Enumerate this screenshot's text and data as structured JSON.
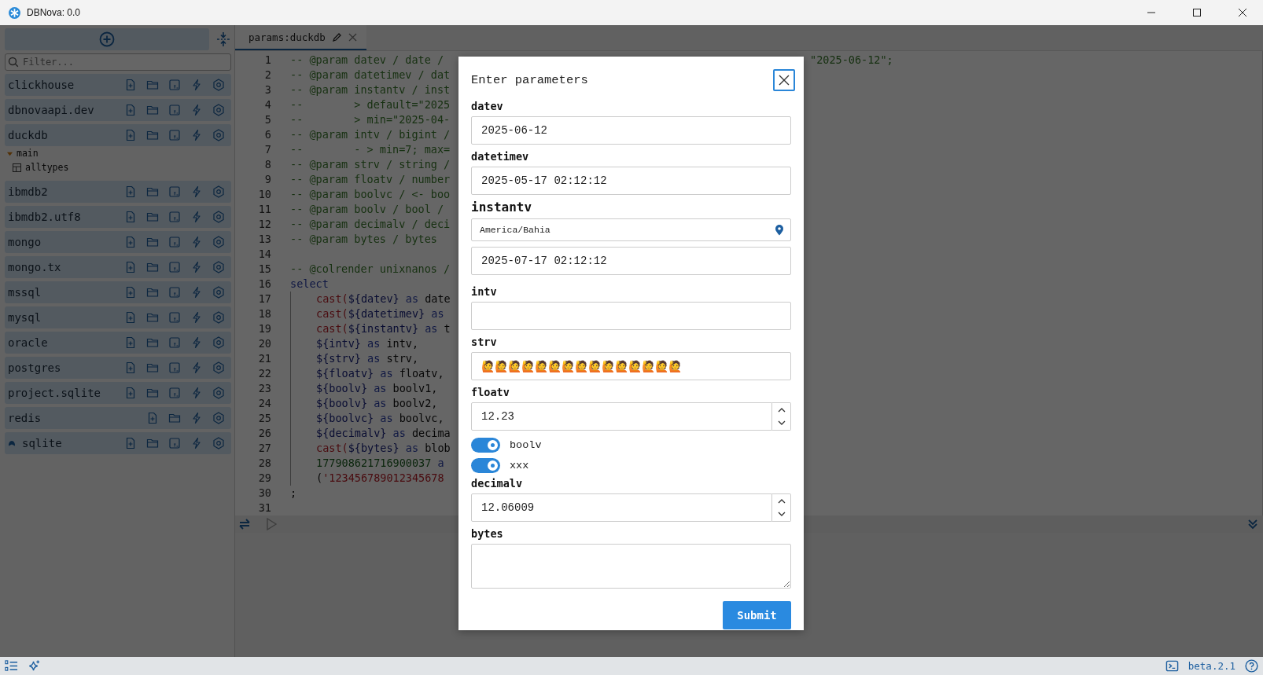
{
  "window": {
    "title": "DBNova: 0.0"
  },
  "sidebar": {
    "filter_placeholder": "Filter...",
    "connections": [
      {
        "name": "clickhouse",
        "pinned": false,
        "actions": [
          {
            "kind": "new-file"
          },
          {
            "kind": "folder"
          },
          {
            "kind": "script"
          },
          {
            "kind": "bolt"
          },
          {
            "kind": "settings"
          }
        ]
      },
      {
        "name": "dbnovaapi.dev",
        "pinned": false,
        "actions": [
          {
            "kind": "new-file"
          },
          {
            "kind": "folder"
          },
          {
            "kind": "script"
          },
          {
            "kind": "bolt"
          },
          {
            "kind": "settings"
          }
        ]
      },
      {
        "name": "duckdb",
        "pinned": false,
        "actions": [
          {
            "kind": "new-file"
          },
          {
            "kind": "folder"
          },
          {
            "kind": "script"
          },
          {
            "kind": "bolt"
          },
          {
            "kind": "settings"
          }
        ],
        "children": [
          {
            "label": "main",
            "expanded": true,
            "children": [
              {
                "label": "alltypes"
              }
            ]
          }
        ]
      },
      {
        "name": "ibmdb2",
        "pinned": false,
        "actions": [
          {
            "kind": "new-file"
          },
          {
            "kind": "folder"
          },
          {
            "kind": "script"
          },
          {
            "kind": "bolt"
          },
          {
            "kind": "settings"
          }
        ]
      },
      {
        "name": "ibmdb2.utf8",
        "pinned": false,
        "actions": [
          {
            "kind": "new-file"
          },
          {
            "kind": "folder"
          },
          {
            "kind": "script"
          },
          {
            "kind": "bolt"
          },
          {
            "kind": "settings"
          }
        ]
      },
      {
        "name": "mongo",
        "pinned": false,
        "actions": [
          {
            "kind": "new-file"
          },
          {
            "kind": "folder"
          },
          {
            "kind": "script"
          },
          {
            "kind": "bolt"
          },
          {
            "kind": "settings"
          }
        ]
      },
      {
        "name": "mongo.tx",
        "pinned": false,
        "actions": [
          {
            "kind": "new-file"
          },
          {
            "kind": "folder"
          },
          {
            "kind": "script"
          },
          {
            "kind": "bolt"
          },
          {
            "kind": "settings"
          }
        ]
      },
      {
        "name": "mssql",
        "pinned": false,
        "actions": [
          {
            "kind": "new-file"
          },
          {
            "kind": "folder"
          },
          {
            "kind": "script"
          },
          {
            "kind": "bolt"
          },
          {
            "kind": "settings"
          }
        ]
      },
      {
        "name": "mysql",
        "pinned": false,
        "actions": [
          {
            "kind": "new-file"
          },
          {
            "kind": "folder"
          },
          {
            "kind": "script"
          },
          {
            "kind": "bolt"
          },
          {
            "kind": "settings"
          }
        ]
      },
      {
        "name": "oracle",
        "pinned": false,
        "actions": [
          {
            "kind": "new-file"
          },
          {
            "kind": "folder"
          },
          {
            "kind": "script"
          },
          {
            "kind": "bolt"
          },
          {
            "kind": "settings"
          }
        ]
      },
      {
        "name": "postgres",
        "pinned": false,
        "actions": [
          {
            "kind": "new-file"
          },
          {
            "kind": "folder"
          },
          {
            "kind": "script"
          },
          {
            "kind": "bolt"
          },
          {
            "kind": "settings"
          }
        ]
      },
      {
        "name": "project.sqlite",
        "pinned": false,
        "actions": [
          {
            "kind": "new-file"
          },
          {
            "kind": "folder"
          },
          {
            "kind": "script"
          },
          {
            "kind": "bolt"
          },
          {
            "kind": "settings"
          }
        ]
      },
      {
        "name": "redis",
        "pinned": false,
        "actions": [
          {
            "kind": "new-file"
          },
          {
            "kind": "folder"
          },
          {
            "kind": "bolt"
          },
          {
            "kind": "settings"
          }
        ]
      },
      {
        "name": "sqlite",
        "pinned": true,
        "actions": [
          {
            "kind": "new-file"
          },
          {
            "kind": "folder"
          },
          {
            "kind": "script"
          },
          {
            "kind": "bolt"
          },
          {
            "kind": "settings"
          }
        ]
      }
    ]
  },
  "editor": {
    "tabs": [
      {
        "label": "params:duckdb",
        "selected": true
      }
    ],
    "lines": [
      {
        "n": "1",
        "kind": "comment",
        "text": "-- @param datev / date /",
        "tail": "\"2025-06-12\";"
      },
      {
        "n": "2",
        "kind": "comment",
        "text": "-- @param datetimev / dat"
      },
      {
        "n": "3",
        "kind": "comment",
        "text": "-- @param instantv / inst"
      },
      {
        "n": "4",
        "kind": "comment",
        "text": "--        > default=\"2025"
      },
      {
        "n": "5",
        "kind": "comment",
        "text": "--        > min=\"2025-04-"
      },
      {
        "n": "6",
        "kind": "comment",
        "text": "-- @param intv / bigint /"
      },
      {
        "n": "7",
        "kind": "comment",
        "text": "--        - > min=7; max="
      },
      {
        "n": "8",
        "kind": "comment",
        "text": "-- @param strv / string /"
      },
      {
        "n": "9",
        "kind": "comment",
        "text": "-- @param floatv / number"
      },
      {
        "n": "10",
        "kind": "comment",
        "text": "-- @param boolvc / <- boo"
      },
      {
        "n": "11",
        "kind": "comment",
        "text": "-- @param boolv / bool /"
      },
      {
        "n": "12",
        "kind": "comment",
        "text": "-- @param decimalv / deci"
      },
      {
        "n": "13",
        "kind": "comment",
        "text": "-- @param bytes / bytes"
      },
      {
        "n": "14",
        "kind": "blank"
      },
      {
        "n": "15",
        "kind": "comment",
        "text": "-- @colrender unixnanos /"
      },
      {
        "n": "16",
        "kind": "keyword",
        "text": "select"
      },
      {
        "n": "17",
        "kind": "body",
        "segments": [
          {
            "t": "cast(",
            "kind": "fn"
          },
          {
            "t": "${datev}",
            "kind": "var"
          },
          {
            "t": " as ",
            "kind": "kw"
          },
          {
            "t": "date",
            "kind": "id"
          }
        ]
      },
      {
        "n": "18",
        "kind": "body",
        "segments": [
          {
            "t": "cast(",
            "kind": "fn"
          },
          {
            "t": "${datetimev}",
            "kind": "var"
          },
          {
            "t": " as",
            "kind": "kw"
          }
        ]
      },
      {
        "n": "19",
        "kind": "body",
        "segments": [
          {
            "t": "cast(",
            "kind": "fn"
          },
          {
            "t": "${instantv}",
            "kind": "var"
          },
          {
            "t": " as ",
            "kind": "kw"
          },
          {
            "t": "t",
            "kind": "id"
          }
        ]
      },
      {
        "n": "20",
        "kind": "body",
        "segments": [
          {
            "t": "${intv}",
            "kind": "var"
          },
          {
            "t": " as ",
            "kind": "kw"
          },
          {
            "t": "intv,",
            "kind": "id"
          }
        ]
      },
      {
        "n": "21",
        "kind": "body",
        "segments": [
          {
            "t": "${strv}",
            "kind": "var"
          },
          {
            "t": " as ",
            "kind": "kw"
          },
          {
            "t": "strv,",
            "kind": "id"
          }
        ]
      },
      {
        "n": "22",
        "kind": "body",
        "segments": [
          {
            "t": "${floatv}",
            "kind": "var"
          },
          {
            "t": " as ",
            "kind": "kw"
          },
          {
            "t": "floatv,",
            "kind": "id"
          }
        ]
      },
      {
        "n": "23",
        "kind": "body",
        "segments": [
          {
            "t": "${boolv}",
            "kind": "var"
          },
          {
            "t": " as ",
            "kind": "kw"
          },
          {
            "t": "boolv1,",
            "kind": "id"
          }
        ]
      },
      {
        "n": "24",
        "kind": "body",
        "segments": [
          {
            "t": "${boolv}",
            "kind": "var"
          },
          {
            "t": " as ",
            "kind": "kw"
          },
          {
            "t": "boolv2,",
            "kind": "id"
          }
        ]
      },
      {
        "n": "25",
        "kind": "body",
        "segments": [
          {
            "t": "${boolvc}",
            "kind": "var"
          },
          {
            "t": " as ",
            "kind": "kw"
          },
          {
            "t": "boolvc,",
            "kind": "id"
          }
        ]
      },
      {
        "n": "26",
        "kind": "body",
        "segments": [
          {
            "t": "${decimalv}",
            "kind": "var"
          },
          {
            "t": " as ",
            "kind": "kw"
          },
          {
            "t": "decima",
            "kind": "id"
          }
        ]
      },
      {
        "n": "27",
        "kind": "body",
        "segments": [
          {
            "t": "cast(",
            "kind": "fn"
          },
          {
            "t": "${bytes}",
            "kind": "var"
          },
          {
            "t": " as ",
            "kind": "kw"
          },
          {
            "t": "blob",
            "kind": "id"
          }
        ]
      },
      {
        "n": "28",
        "kind": "body",
        "segments": [
          {
            "t": "177908621716900037",
            "kind": "num"
          },
          {
            "t": " a",
            "kind": "kw"
          }
        ]
      },
      {
        "n": "29",
        "kind": "body",
        "segments": [
          {
            "t": "(",
            "kind": "id"
          },
          {
            "t": "'123456789012345678",
            "kind": "str"
          }
        ]
      },
      {
        "n": "30",
        "kind": "plain",
        "text": ";"
      },
      {
        "n": "31",
        "kind": "blank"
      }
    ]
  },
  "status_bar": {
    "version": "beta.2.1"
  },
  "dialog": {
    "title": "Enter parameters",
    "fields": [
      {
        "kind": "text",
        "label": "datev",
        "value": "2025-06-12"
      },
      {
        "kind": "text",
        "label": "datetimev",
        "value": "2025-05-17 02:12:12"
      },
      {
        "kind": "instant",
        "label": "instantv",
        "zone": "America/Bahia",
        "value": "2025-07-17 02:12:12"
      },
      {
        "kind": "text",
        "label": "intv"
      },
      {
        "kind": "text",
        "label": "strv",
        "value": "🙋🙋🙋🙋🙋🙋🙋🙋🙋🙋🙋🙋🙋🙋🙋"
      },
      {
        "kind": "number",
        "label": "floatv",
        "value": "12.23"
      },
      {
        "kind": "toggle",
        "label": "boolv",
        "on": true
      },
      {
        "kind": "toggle",
        "label": "xxx",
        "on": true
      },
      {
        "kind": "number",
        "label": "decimalv",
        "value": "12.06009"
      },
      {
        "kind": "textarea",
        "label": "bytes"
      }
    ],
    "submit": "Submit"
  }
}
